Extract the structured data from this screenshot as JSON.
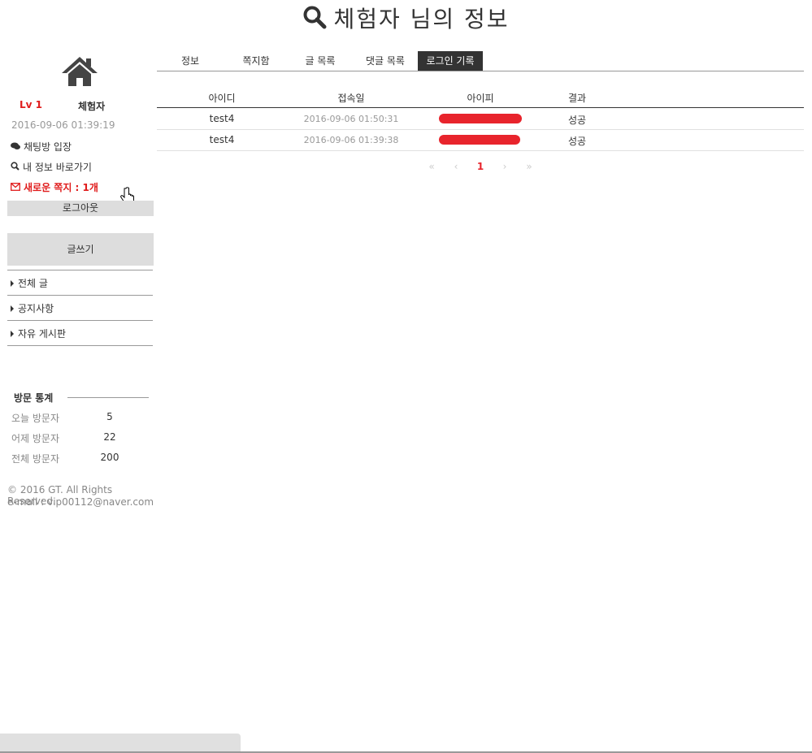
{
  "title": "체험자 님의 정보",
  "sidebar": {
    "level": "Lv 1",
    "nickname": "체험자",
    "last_login": "2016-09-06 01:39:19",
    "links": {
      "chat": "채팅방 입장",
      "my_info": "내 정보 바로가기",
      "new_message": "새로운 쪽지 : 1개"
    },
    "logout": "로그아웃",
    "write": "글쓰기",
    "menu": [
      "전체 글",
      "공지사항",
      "자유 게시판"
    ],
    "stats": {
      "title": "방문 통계",
      "rows": [
        {
          "label": "오늘 방문자",
          "value": "5"
        },
        {
          "label": "어제 방문자",
          "value": "22"
        },
        {
          "label": "전체 방문자",
          "value": "200"
        }
      ]
    },
    "footer": {
      "copyright": "© 2016 GT. All Rights Reserved.",
      "email": "e-mail : vip00112@naver.com"
    }
  },
  "tabs": [
    "정보",
    "쪽지함",
    "글 목록",
    "댓글 목록",
    "로그인 기록"
  ],
  "active_tab": "로그인 기록",
  "table": {
    "headers": [
      "아이디",
      "접속일",
      "아이피",
      "결과"
    ],
    "rows": [
      {
        "id": "test4",
        "date": "2016-09-06 01:50:31",
        "result": "성공"
      },
      {
        "id": "test4",
        "date": "2016-09-06 01:39:38",
        "result": "성공"
      }
    ]
  },
  "pagination": {
    "first": "«",
    "prev": "‹",
    "current": "1",
    "next": "›",
    "last": "»"
  },
  "colors": {
    "accent": "#e8242c",
    "active_tab": "#333333",
    "button_gray": "#dddddd"
  }
}
